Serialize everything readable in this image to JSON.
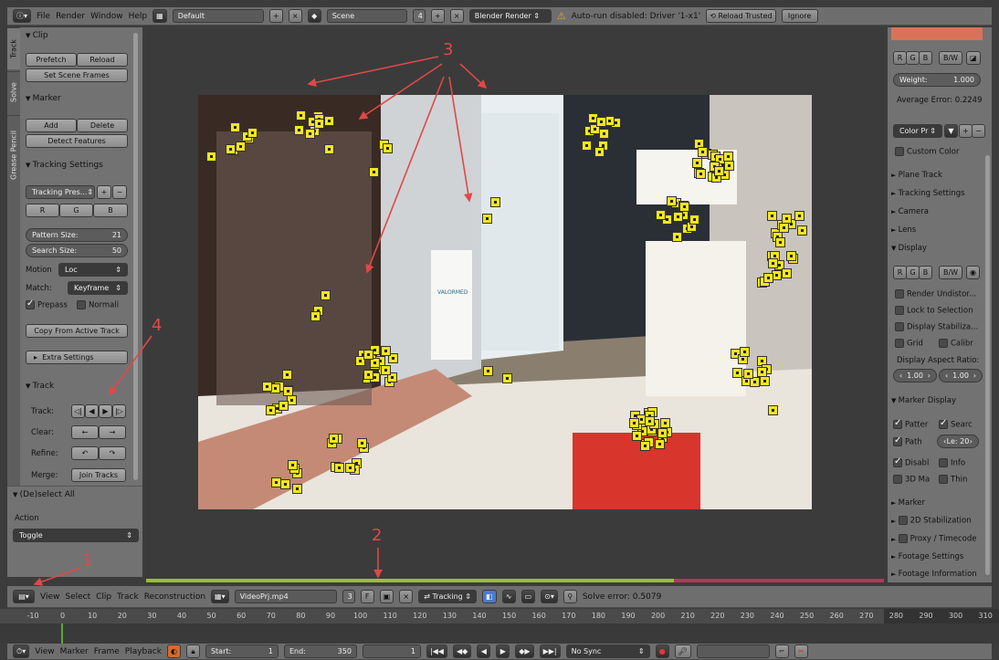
{
  "top_bar": {
    "menus": [
      "File",
      "Render",
      "Window",
      "Help"
    ],
    "layout": "Default",
    "scene": "Scene",
    "scene_count": "4",
    "engine": "Blender Render",
    "warning": "Auto-run disabled: Driver '1-x1'",
    "reload_trusted": "Reload Trusted",
    "ignore": "Ignore"
  },
  "tabs": [
    "Track",
    "Solve",
    "Grease Pencil"
  ],
  "left_panel": {
    "clip": {
      "title": "Clip",
      "prefetch": "Prefetch",
      "reload": "Reload",
      "set_scene_frames": "Set Scene Frames"
    },
    "marker": {
      "title": "Marker",
      "add": "Add",
      "delete": "Delete",
      "detect": "Detect Features"
    },
    "tracking_settings": {
      "title": "Tracking Settings",
      "preset": "Tracking Pres...",
      "r": "R",
      "g": "G",
      "b": "B",
      "pattern_size_label": "Pattern Size:",
      "pattern_size": "21",
      "search_size_label": "Search Size:",
      "search_size": "50",
      "motion_label": "Motion",
      "motion": "Loc",
      "match_label": "Match:",
      "match": "Keyframe",
      "prepass": "Prepass",
      "normalize": "Normali",
      "copy_from_active": "Copy From Active Track",
      "extra_settings": "Extra Settings"
    },
    "track": {
      "title": "Track",
      "track_label": "Track:",
      "clear_label": "Clear:",
      "refine_label": "Refine:",
      "merge_label": "Merge:",
      "join_tracks": "Join Tracks"
    },
    "deselect": {
      "title": "(De)select All",
      "action_label": "Action",
      "action": "Toggle"
    }
  },
  "right_panel": {
    "r": "R",
    "g": "G",
    "b": "B",
    "bw": "B/W",
    "weight_label": "Weight:",
    "weight": "1.000",
    "average_error": "Average Error: 0.2249",
    "color_preset": "Color Pr",
    "custom_color": "Custom Color",
    "sections_top": [
      "Plane Track",
      "Tracking Settings",
      "Camera",
      "Lens"
    ],
    "display": {
      "title": "Display",
      "render_undistort": "Render Undistor...",
      "lock_to_selection": "Lock to Selection",
      "display_stabilization": "Display Stabiliza...",
      "grid": "Grid",
      "calibr": "Calibr",
      "aspect_label": "Display Aspect Ratio:",
      "aspect_x": "1.00",
      "aspect_y": "1.00"
    },
    "marker_display": {
      "title": "Marker Display",
      "pattern": "Patter",
      "search": "Searc",
      "path": "Path",
      "length": "Le: 20",
      "disabled": "Disabl",
      "info": "Info",
      "3d_markers": "3D Ma",
      "thin": "Thin"
    },
    "sections_bottom": [
      "Marker",
      "2D Stabilization",
      "Proxy / Timecode",
      "Footage Settings",
      "Footage Information"
    ]
  },
  "clip_bar": {
    "menus": [
      "View",
      "Select",
      "Clip",
      "Track",
      "Reconstruction"
    ],
    "clip_name": "VideoPrj.mp4",
    "users": "3",
    "fake": "F",
    "mode": "Tracking",
    "solve_error": "Solve error: 0.5079"
  },
  "ruler_ticks": [
    "-10",
    "0",
    "10",
    "20",
    "30",
    "40",
    "50",
    "60",
    "70",
    "80",
    "90",
    "100",
    "110",
    "120",
    "130",
    "140",
    "150",
    "160",
    "170",
    "180",
    "190",
    "200",
    "210",
    "220",
    "230",
    "240",
    "250",
    "260",
    "270",
    "280",
    "290",
    "300",
    "310"
  ],
  "bottom_bar": {
    "menus": [
      "View",
      "Marker",
      "Frame",
      "Playback"
    ],
    "start_label": "Start:",
    "start": "1",
    "end_label": "End:",
    "end": "350",
    "current": "1",
    "sync": "No Sync"
  },
  "annotations": [
    "1",
    "2",
    "3",
    "4"
  ],
  "footage_label": "VALORMED",
  "colors": {
    "marker": "#f4e61a",
    "annotation": "#e04848",
    "timeline_progress": "#9bbf2e",
    "timeline_end": "#b0385a"
  }
}
